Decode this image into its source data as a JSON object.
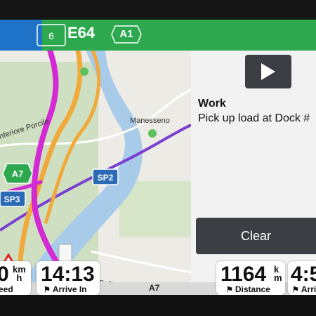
{
  "colors": {
    "top_bar": "#2ea84f",
    "blue_tab": "#1e73c8",
    "route": "#d42ad4",
    "clear_button": "#3b3f44"
  },
  "route_header": {
    "tab_number": "6",
    "road_primary": "E64",
    "road_secondary": "A1"
  },
  "map": {
    "places": [
      "Manesseno",
      "nferiore Porcile",
      "Salita Bocchettina"
    ],
    "shields": {
      "a7": "A7",
      "sp2": "SP2",
      "sp3": "SP3"
    }
  },
  "work_card": {
    "title": "Work",
    "description": "Pick up load at Dock #",
    "play_icon": "play-icon",
    "clear_label": "Clear"
  },
  "data_fields": {
    "speed": {
      "value": "0",
      "unit_top": "km",
      "unit_bottom": "h",
      "label": "eed"
    },
    "arrive": {
      "value": "14:13",
      "label": "Arrive In"
    },
    "distance": {
      "value": "1164",
      "unit_top": "k",
      "unit_bottom": "m",
      "label": "Distance"
    },
    "time": {
      "value": "4:5",
      "label": "Arrive"
    }
  },
  "road_name": "A7"
}
